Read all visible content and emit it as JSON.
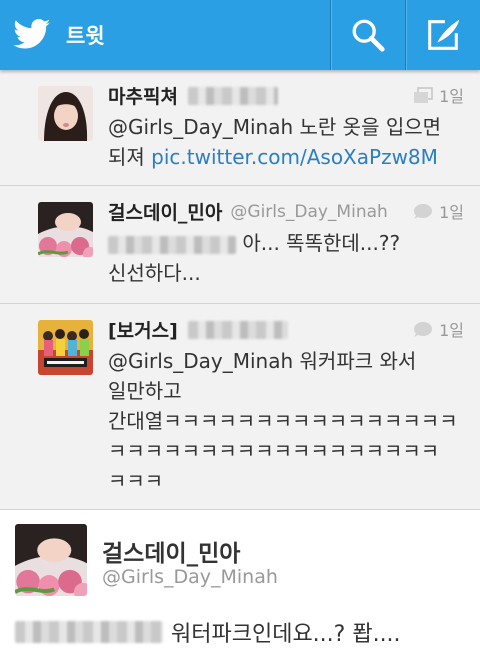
{
  "header": {
    "title": "트윗",
    "logo_icon": "twitter-bird-icon",
    "search_icon": "search-icon",
    "compose_icon": "compose-icon",
    "bar_color": "#2a9fe4"
  },
  "tweets": [
    {
      "name": "마추픽쳐",
      "handle": "",
      "time": "1일",
      "meta_icon": "gallery-icon",
      "lines": [
        "@Girls_Day_Minah 노란 옷을 입으면",
        "되져 "
      ],
      "link": "pic.twitter.com/AsoXaPzw8M"
    },
    {
      "name": "걸스데이_민아",
      "handle": "@Girls_Day_Minah",
      "time": "1일",
      "meta_icon": "reply-bubble-icon",
      "lines": [
        " 아... 똑똑한데...??",
        "신선하다..."
      ]
    },
    {
      "name": "[보거스]",
      "handle": "",
      "time": "1일",
      "meta_icon": "reply-bubble-icon",
      "lines": [
        "@Girls_Day_Minah 워커파크 와서",
        "일만하고",
        "간대열ㅋㅋㅋㅋㅋㅋㅋㅋㅋㅋㅋㅋㅋㅋㅋㅋ",
        "ㅋㅋㅋㅋㅋㅋㅋㅋㅋㅋㅋㅋㅋㅋㅋㅋㅋㅋ",
        "ㅋㅋㅋ"
      ]
    }
  ],
  "detail": {
    "name": "걸스데이_민아",
    "handle": "@Girls_Day_Minah",
    "text": "워터파크인데요...? 퐙...."
  }
}
